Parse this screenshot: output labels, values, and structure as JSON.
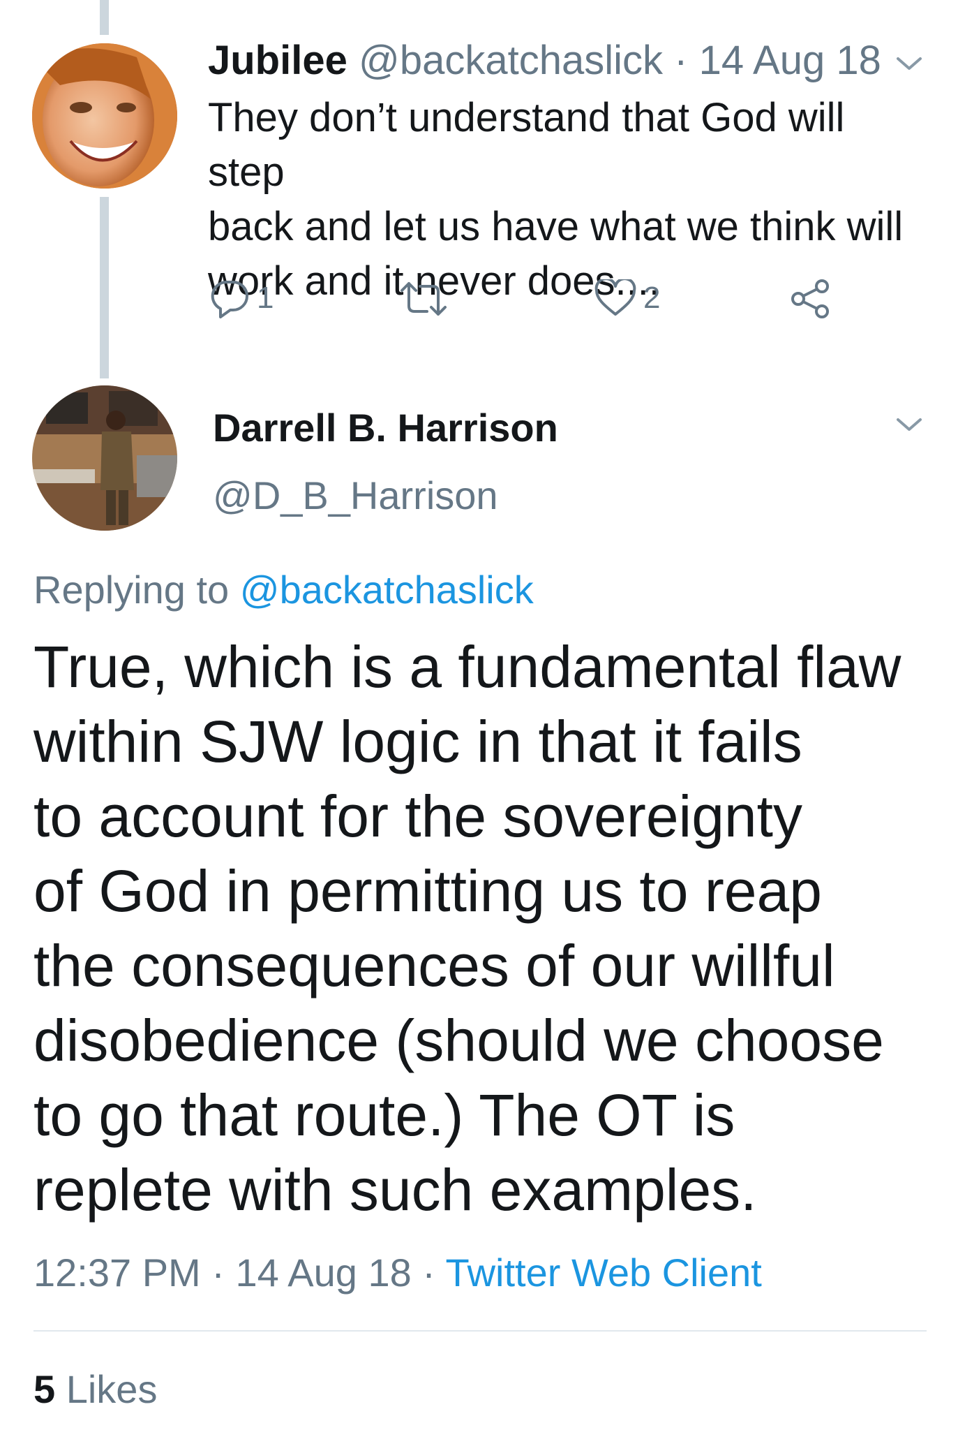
{
  "parent_tweet": {
    "display_name": "Jubilee",
    "handle": "@backatchaslick",
    "separator": "·",
    "date": "14 Aug 18",
    "text": "They don’t understand that God will step\nback and let us have what we think will\nwork and it never does....",
    "reply_count": "1",
    "like_count": "2",
    "icons": [
      "reply-icon",
      "retweet-icon",
      "like-icon",
      "share-icon",
      "chevron-down-icon"
    ]
  },
  "main_tweet": {
    "display_name": "Darrell B. Harrison",
    "handle": "@D_B_Harrison",
    "replying_prefix": "Replying to",
    "replying_to": "@backatchaslick",
    "text": "True, which is a fundamental flaw\nwithin SJW logic in that it fails\nto account for the sovereignty\nof God in permitting us to reap\nthe consequences of our willful\ndisobedience (should we choose\nto go that route.) The OT is\nreplete with such examples.",
    "time": "12:37 PM",
    "separator": "·",
    "date": "14 Aug 18",
    "client": "Twitter Web Client",
    "likes_count": "5",
    "likes_label": "Likes"
  },
  "colors": {
    "text": "#14171a",
    "secondary": "#657786",
    "link": "#1b95e0",
    "thread_line": "#ccd6dd",
    "divider": "#e1e8ed"
  }
}
